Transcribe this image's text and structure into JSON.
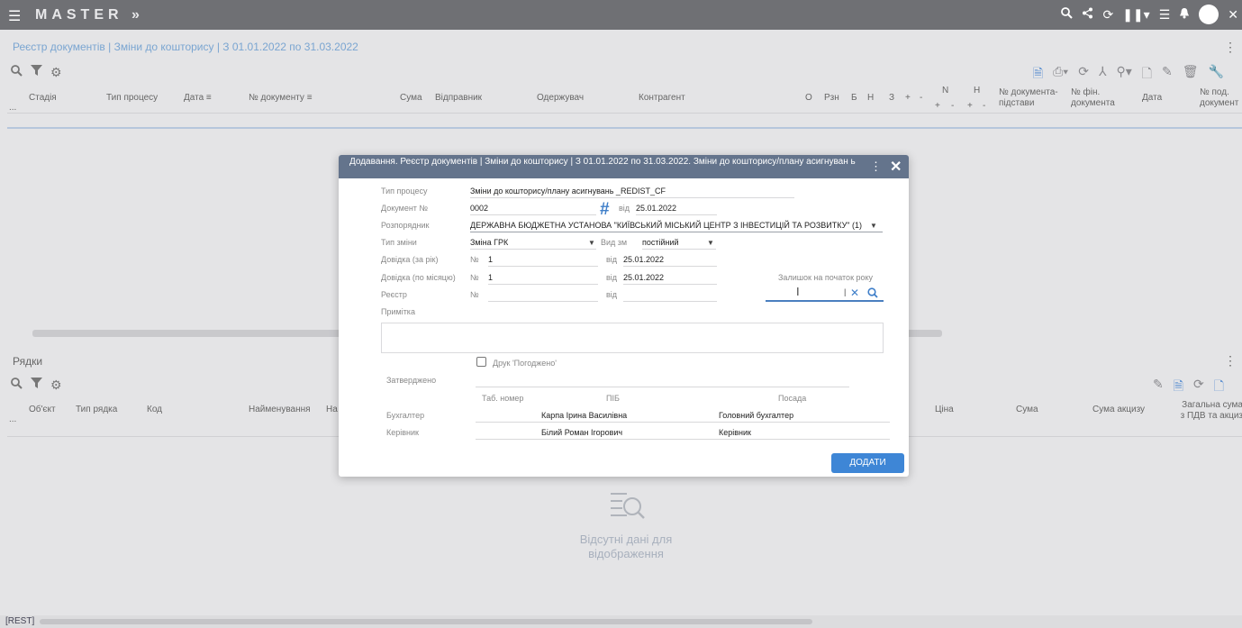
{
  "app": {
    "brand": "MASTER",
    "brand_suffix": "»"
  },
  "topbar_icons": [
    "search-icon",
    "share-icon",
    "refresh-icon",
    "pause-icon",
    "list-icon",
    "bell-icon",
    "avatar",
    "close-icon"
  ],
  "header": {
    "title": "Реєстр документів | Зміни до кошторису | З 01.01.2022 по 31.03.2022"
  },
  "upper_grid": {
    "columns": [
      "Стадія",
      "Тип процесу",
      "Дата",
      "№ документу",
      "Сума",
      "Відправник",
      "Одержувач",
      "Контрагент",
      "О",
      "Рзн",
      "Б",
      "Н",
      "З",
      "+",
      "-",
      "N",
      "Н",
      "№ документа-підстави",
      "№ фін. документа",
      "Дата",
      "№ под. документ"
    ],
    "n_sub": [
      "+",
      "-"
    ],
    "h_sub": [
      "+",
      "-"
    ],
    "ellipsis": "..."
  },
  "lines_section": {
    "title": "Рядки",
    "columns": [
      "Об'єкт",
      "Тип рядка",
      "Код",
      "Найменування",
      "На",
      "Ціна",
      "Сума",
      "Сума акцизу",
      "Загальна сума з ПДВ та акциз"
    ],
    "ellipsis": "...",
    "empty_line1": "Відсутні дані для",
    "empty_line2": "відображення"
  },
  "status": {
    "label": "[REST]"
  },
  "dialog": {
    "title": "Додавання. Реєстр документів | Зміни до кошторису | З 01.01.2022 по 31.03.2022. Зміни до кошторису/плану асигнуван ь",
    "labels": {
      "process_type": "Тип процесу",
      "doc_no": "Документ №",
      "from": "від",
      "manager": "Розпорядник",
      "change_type": "Тип зміни",
      "change_kind": "Вид зм",
      "ref_year": "Довідка (за рік)",
      "ref_month": "Довідка (по місяцю)",
      "registry": "Реєстр",
      "no_sign": "№",
      "balance": "Залишок на початок року",
      "note": "Примітка",
      "print_agreed": "Друк 'Погоджено'",
      "approved": "Затверджено",
      "tab_no": "Таб. номер",
      "pib": "ПІБ",
      "position": "Посада",
      "accountant": "Бухгалтер",
      "head": "Керівник"
    },
    "values": {
      "process_type": "Зміни до кошторису/плану асигнувань _REDIST_CF",
      "doc_no": "0002",
      "doc_date": "25.01.2022",
      "manager": "ДЕРЖАВНА БЮДЖЕТНА УСТАНОВА \"КИЇВСЬКИЙ МІСЬКИЙ ЦЕНТР З ІНВЕСТИЦІЙ ТА РОЗВИТКУ\" (1)",
      "change_type": "Зміна ГРК",
      "change_kind": "постійний",
      "ref_year_no": "1",
      "ref_year_date": "25.01.2022",
      "ref_month_no": "1",
      "ref_month_date": "25.01.2022",
      "accountant_name": "Карпа Ірина Василівна",
      "accountant_position": "Головний бухгалтер",
      "head_name": "Білий Роман Ігорович",
      "head_position": "Керівник"
    },
    "button_add": "ДОДАТИ"
  }
}
